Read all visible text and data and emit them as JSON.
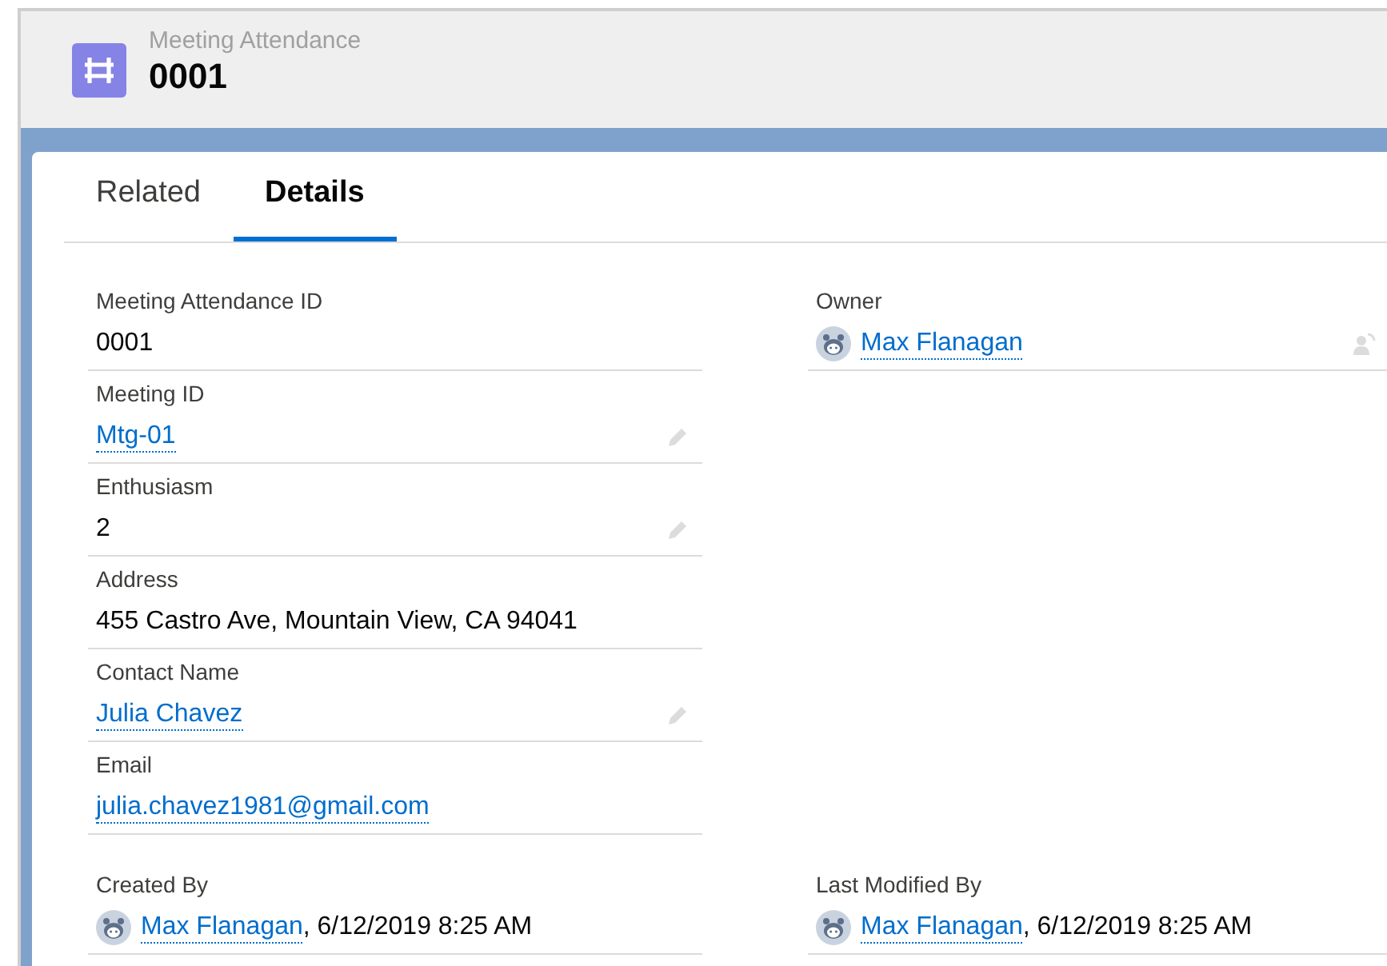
{
  "header": {
    "object_label": "Meeting Attendance",
    "record_name": "0001"
  },
  "tabs": [
    {
      "label": "Related",
      "selected": false
    },
    {
      "label": "Details",
      "selected": true
    }
  ],
  "left_fields": [
    {
      "label": "Meeting Attendance ID",
      "value": "0001",
      "kind": "text",
      "editable": false
    },
    {
      "label": "Meeting ID",
      "value": "Mtg-01",
      "kind": "link",
      "editable": true
    },
    {
      "label": "Enthusiasm",
      "value": "2",
      "kind": "text",
      "editable": true
    },
    {
      "label": "Address",
      "value": "455 Castro Ave, Mountain View, CA 94041",
      "kind": "text",
      "editable": false
    },
    {
      "label": "Contact Name",
      "value": "Julia Chavez",
      "kind": "link",
      "editable": true
    },
    {
      "label": "Email",
      "value": "julia.chavez1981@gmail.com",
      "kind": "link",
      "editable": false
    }
  ],
  "right_fields": [
    {
      "label": "Owner",
      "value": "Max Flanagan",
      "kind": "user",
      "owner_changeable": true
    }
  ],
  "system_fields": [
    {
      "label": "Created By",
      "value": "Max Flanagan",
      "date": ", 6/12/2019 8:25 AM",
      "kind": "user",
      "editable": false
    },
    {
      "label": "Last Modified By",
      "value": "Max Flanagan",
      "date": ", 6/12/2019 8:25 AM",
      "kind": "user",
      "editable": false
    }
  ]
}
